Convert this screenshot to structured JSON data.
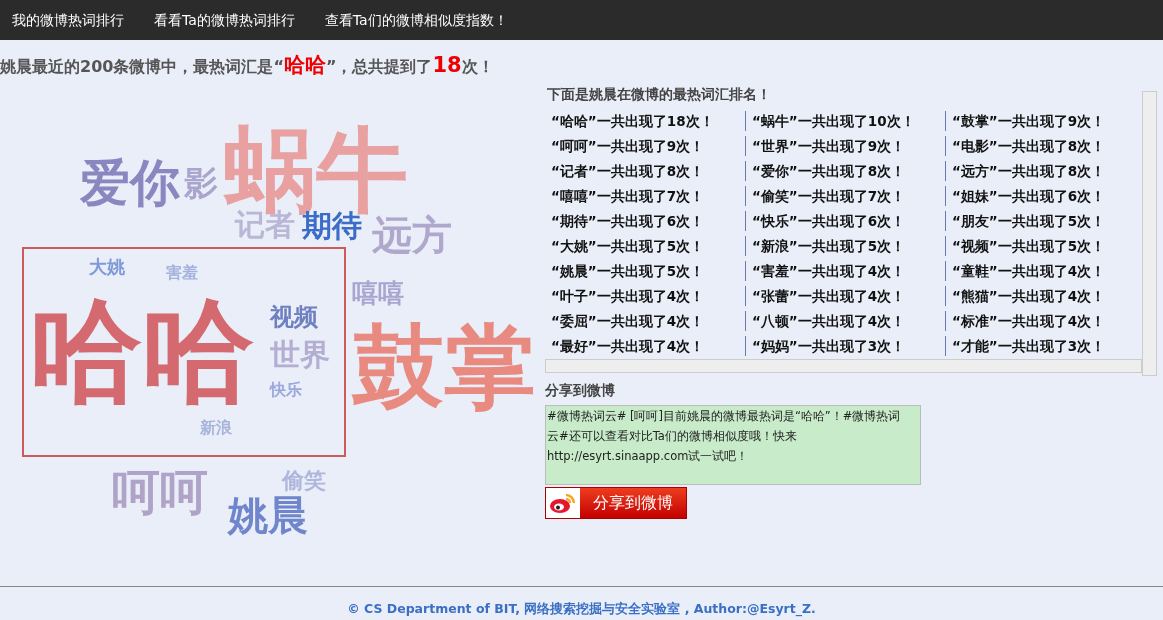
{
  "nav": [
    {
      "label": "我的微博热词排行"
    },
    {
      "label": "看看Ta的微博热词排行"
    },
    {
      "label": "查看Ta们的微博相似度指数！"
    }
  ],
  "headline": {
    "before": "姚晨最近的200条微博中，最热词汇是“",
    "hot_word": "哈哈",
    "middle": "”，总共提到了",
    "count": "18",
    "after": "次！"
  },
  "cloud": {
    "words": [
      {
        "text": "爱你",
        "color": "#8a87c0"
      },
      {
        "text": "影",
        "color": "#aaa5cc"
      },
      {
        "text": "蜗牛",
        "color": "#e8a0a0"
      },
      {
        "text": "记者",
        "color": "#bab6d6"
      },
      {
        "text": "期待",
        "color": "#3a6cc8"
      },
      {
        "text": "远方",
        "color": "#b0a8cc"
      },
      {
        "text": "大姚",
        "color": "#7f9ad8"
      },
      {
        "text": "害羞",
        "color": "#a4b2dd"
      },
      {
        "text": "嘻嘻",
        "color": "#a9a5d0"
      },
      {
        "text": "哈哈",
        "color": "#d46a6f"
      },
      {
        "text": "视频",
        "color": "#6f80c0"
      },
      {
        "text": "世界",
        "color": "#b3aed2"
      },
      {
        "text": "快乐",
        "color": "#9aa8dc"
      },
      {
        "text": "鼓掌",
        "color": "#e88a80"
      },
      {
        "text": "新浪",
        "color": "#a8b4dc"
      },
      {
        "text": "呵呵",
        "color": "#b0a3c8"
      },
      {
        "text": "偷笑",
        "color": "#aeb6dc"
      },
      {
        "text": "姚晨",
        "color": "#6f86cc"
      }
    ]
  },
  "ranking": {
    "title": "下面是姚晨在微博的最热词汇排名！",
    "rows": [
      [
        "“哈哈”一共出现了18次！",
        "“蜗牛”一共出现了10次！",
        "“鼓掌”一共出现了9次！"
      ],
      [
        "“呵呵”一共出现了9次！",
        "“世界”一共出现了9次！",
        "“电影”一共出现了8次！"
      ],
      [
        "“记者”一共出现了8次！",
        "“爱你”一共出现了8次！",
        "“远方”一共出现了8次！"
      ],
      [
        "“嘻嘻”一共出现了7次！",
        "“偷笑”一共出现了7次！",
        "“姐妹”一共出现了6次！"
      ],
      [
        "“期待”一共出现了6次！",
        "“快乐”一共出现了6次！",
        "“朋友”一共出现了5次！"
      ],
      [
        "“大姚”一共出现了5次！",
        "“新浪”一共出现了5次！",
        "“视频”一共出现了5次！"
      ],
      [
        "“姚晨”一共出现了5次！",
        "“害羞”一共出现了4次！",
        "“童鞋”一共出现了4次！"
      ],
      [
        "“叶子”一共出现了4次！",
        "“张蕾”一共出现了4次！",
        "“熊猫”一共出现了4次！"
      ],
      [
        "“委屈”一共出现了4次！",
        "“八顿”一共出现了4次！",
        "“标准”一共出现了4次！"
      ],
      [
        "“最好”一共出现了4次！",
        "“妈妈”一共出现了3次！",
        "“才能”一共出现了3次！"
      ]
    ]
  },
  "share": {
    "title": "分享到微博",
    "text": "#微博热词云# [呵呵]目前姚晨的微博最热词是“哈哈”！#微博热词云#还可以查看对比Ta们的微博相似度哦！快来http://esyrt.sinaapp.com试一试吧！",
    "button": "分享到微博"
  },
  "footer": "© CS Department of BIT, 网络搜索挖掘与安全实验室 , Author:@Esyrt_Z."
}
